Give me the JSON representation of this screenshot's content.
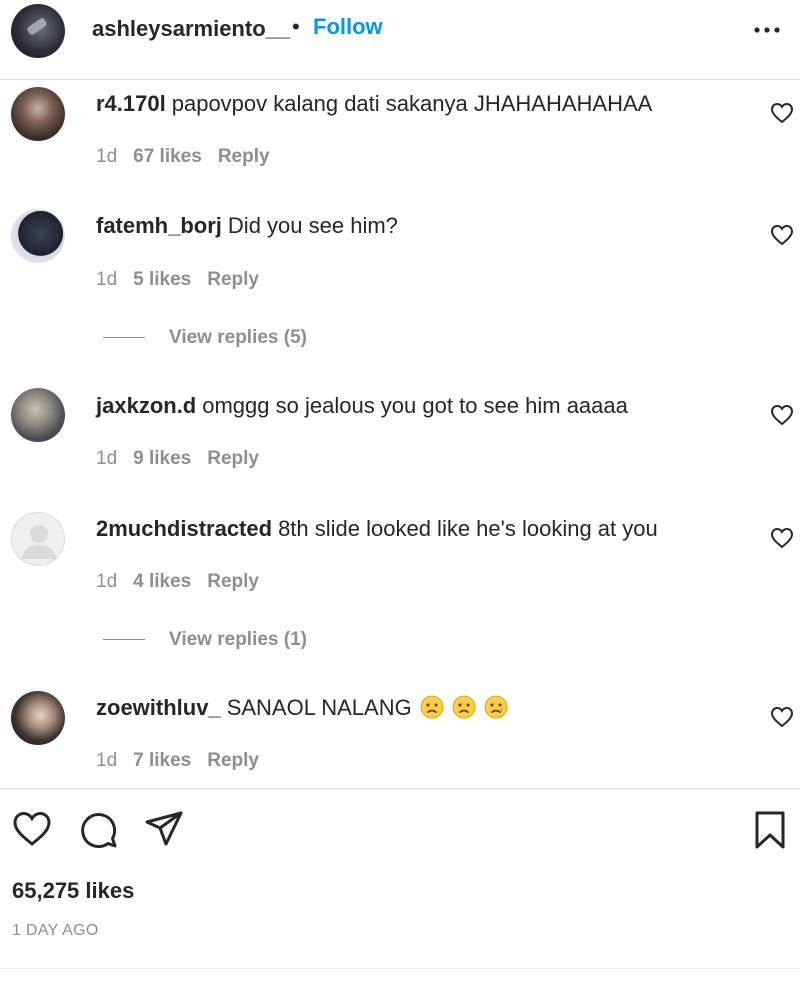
{
  "header": {
    "username": "ashleysarmiento__",
    "separator": "•",
    "follow_label": "Follow",
    "more_icon": "more-horizontal-icon"
  },
  "comments": [
    {
      "username": "r4.170l",
      "text": "papovpov kalang dati sakanya JHAHAHAHAHAA",
      "time": "1d",
      "likes": "67 likes",
      "reply_label": "Reply"
    },
    {
      "username": "fatemh_borj",
      "text": "Did you see him?",
      "time": "1d",
      "likes": "5 likes",
      "reply_label": "Reply",
      "view_replies": "View replies (5)"
    },
    {
      "username": "jaxkzon.d",
      "text": "omggg so jealous you got to see him aaaaa",
      "time": "1d",
      "likes": "9 likes",
      "reply_label": "Reply"
    },
    {
      "username": "2muchdistracted",
      "text": "8th slide looked like he's looking at you",
      "time": "1d",
      "likes": "4 likes",
      "reply_label": "Reply",
      "view_replies": "View replies (1)"
    },
    {
      "username": "zoewithluv_",
      "text": "SANAOL NALANG",
      "emojis": [
        "sad-face-emoji",
        "sad-face-emoji",
        "crying-face-emoji"
      ],
      "time": "1d",
      "likes": "7 likes",
      "reply_label": "Reply"
    }
  ],
  "actions": {
    "like_icon": "heart-icon",
    "comment_icon": "comment-icon",
    "share_icon": "send-icon",
    "save_icon": "bookmark-icon"
  },
  "post": {
    "likes": "65,275 likes",
    "timestamp": "1 DAY AGO"
  },
  "colors": {
    "accent": "#0095f6",
    "text": "#262626",
    "muted": "#8e8e8e",
    "divider": "#dbdbdb"
  }
}
